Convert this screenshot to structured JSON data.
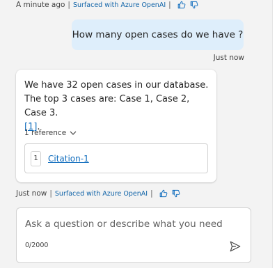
{
  "top_meta": {
    "time": "A minute ago",
    "separator": "|",
    "azure_label": "Surfaced with Azure OpenAI"
  },
  "user_message": {
    "text": "How many open cases do we have ?",
    "time": "Just now"
  },
  "bot_message": {
    "line1": "We have 32 open cases in our database.",
    "line2": "The top 3 cases are: Case 1, Case 2, Case 3.",
    "ref_text": "[1]",
    "ref_suffix": ".",
    "references_toggle": "1 reference",
    "citation": {
      "number": "1",
      "label": "Citation-1"
    }
  },
  "bottom_meta": {
    "time": "Just now",
    "separator": "|",
    "azure_label": "Surfaced with Azure OpenAI"
  },
  "input": {
    "placeholder": "Ask a question or describe what you need",
    "counter": "0/2000"
  },
  "colors": {
    "accent": "#0f6cbd",
    "user_bubble": "#deeefb",
    "background": "#f3f3f3"
  },
  "icons": [
    "thumbs-up-icon",
    "thumbs-down-icon",
    "chevron-down-icon",
    "send-icon"
  ]
}
